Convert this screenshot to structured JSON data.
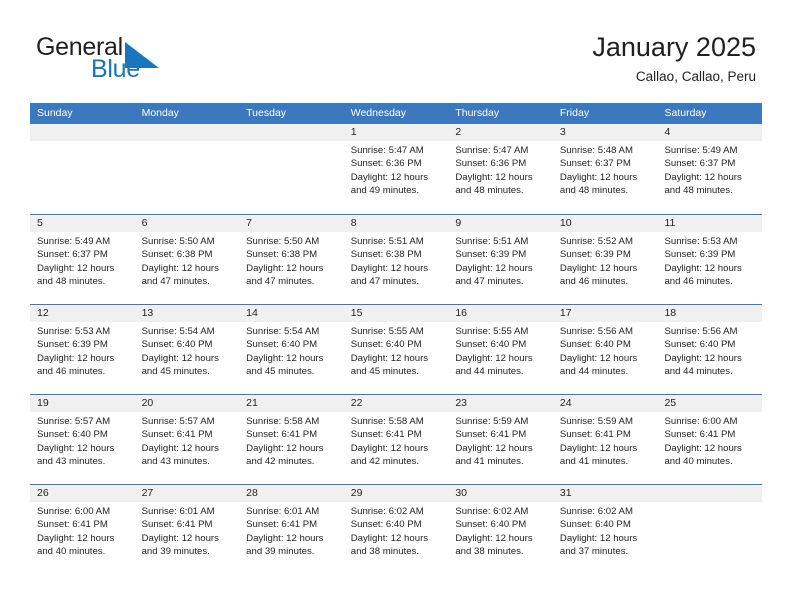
{
  "brand": {
    "name_part1": "General",
    "name_part2": "Blue",
    "flag_color": "#1b75bb",
    "text_color": "#231f20"
  },
  "header": {
    "title": "January 2025",
    "location": "Callao, Callao, Peru",
    "accent_color": "#3b78bd",
    "day_band_color": "#f0f0f0"
  },
  "weekdays": [
    "Sunday",
    "Monday",
    "Tuesday",
    "Wednesday",
    "Thursday",
    "Friday",
    "Saturday"
  ],
  "weeks": [
    [
      {
        "day": "",
        "lines": []
      },
      {
        "day": "",
        "lines": []
      },
      {
        "day": "",
        "lines": []
      },
      {
        "day": "1",
        "lines": [
          "Sunrise: 5:47 AM",
          "Sunset: 6:36 PM",
          "Daylight: 12 hours",
          "and 49 minutes."
        ]
      },
      {
        "day": "2",
        "lines": [
          "Sunrise: 5:47 AM",
          "Sunset: 6:36 PM",
          "Daylight: 12 hours",
          "and 48 minutes."
        ]
      },
      {
        "day": "3",
        "lines": [
          "Sunrise: 5:48 AM",
          "Sunset: 6:37 PM",
          "Daylight: 12 hours",
          "and 48 minutes."
        ]
      },
      {
        "day": "4",
        "lines": [
          "Sunrise: 5:49 AM",
          "Sunset: 6:37 PM",
          "Daylight: 12 hours",
          "and 48 minutes."
        ]
      }
    ],
    [
      {
        "day": "5",
        "lines": [
          "Sunrise: 5:49 AM",
          "Sunset: 6:37 PM",
          "Daylight: 12 hours",
          "and 48 minutes."
        ]
      },
      {
        "day": "6",
        "lines": [
          "Sunrise: 5:50 AM",
          "Sunset: 6:38 PM",
          "Daylight: 12 hours",
          "and 47 minutes."
        ]
      },
      {
        "day": "7",
        "lines": [
          "Sunrise: 5:50 AM",
          "Sunset: 6:38 PM",
          "Daylight: 12 hours",
          "and 47 minutes."
        ]
      },
      {
        "day": "8",
        "lines": [
          "Sunrise: 5:51 AM",
          "Sunset: 6:38 PM",
          "Daylight: 12 hours",
          "and 47 minutes."
        ]
      },
      {
        "day": "9",
        "lines": [
          "Sunrise: 5:51 AM",
          "Sunset: 6:39 PM",
          "Daylight: 12 hours",
          "and 47 minutes."
        ]
      },
      {
        "day": "10",
        "lines": [
          "Sunrise: 5:52 AM",
          "Sunset: 6:39 PM",
          "Daylight: 12 hours",
          "and 46 minutes."
        ]
      },
      {
        "day": "11",
        "lines": [
          "Sunrise: 5:53 AM",
          "Sunset: 6:39 PM",
          "Daylight: 12 hours",
          "and 46 minutes."
        ]
      }
    ],
    [
      {
        "day": "12",
        "lines": [
          "Sunrise: 5:53 AM",
          "Sunset: 6:39 PM",
          "Daylight: 12 hours",
          "and 46 minutes."
        ]
      },
      {
        "day": "13",
        "lines": [
          "Sunrise: 5:54 AM",
          "Sunset: 6:40 PM",
          "Daylight: 12 hours",
          "and 45 minutes."
        ]
      },
      {
        "day": "14",
        "lines": [
          "Sunrise: 5:54 AM",
          "Sunset: 6:40 PM",
          "Daylight: 12 hours",
          "and 45 minutes."
        ]
      },
      {
        "day": "15",
        "lines": [
          "Sunrise: 5:55 AM",
          "Sunset: 6:40 PM",
          "Daylight: 12 hours",
          "and 45 minutes."
        ]
      },
      {
        "day": "16",
        "lines": [
          "Sunrise: 5:55 AM",
          "Sunset: 6:40 PM",
          "Daylight: 12 hours",
          "and 44 minutes."
        ]
      },
      {
        "day": "17",
        "lines": [
          "Sunrise: 5:56 AM",
          "Sunset: 6:40 PM",
          "Daylight: 12 hours",
          "and 44 minutes."
        ]
      },
      {
        "day": "18",
        "lines": [
          "Sunrise: 5:56 AM",
          "Sunset: 6:40 PM",
          "Daylight: 12 hours",
          "and 44 minutes."
        ]
      }
    ],
    [
      {
        "day": "19",
        "lines": [
          "Sunrise: 5:57 AM",
          "Sunset: 6:40 PM",
          "Daylight: 12 hours",
          "and 43 minutes."
        ]
      },
      {
        "day": "20",
        "lines": [
          "Sunrise: 5:57 AM",
          "Sunset: 6:41 PM",
          "Daylight: 12 hours",
          "and 43 minutes."
        ]
      },
      {
        "day": "21",
        "lines": [
          "Sunrise: 5:58 AM",
          "Sunset: 6:41 PM",
          "Daylight: 12 hours",
          "and 42 minutes."
        ]
      },
      {
        "day": "22",
        "lines": [
          "Sunrise: 5:58 AM",
          "Sunset: 6:41 PM",
          "Daylight: 12 hours",
          "and 42 minutes."
        ]
      },
      {
        "day": "23",
        "lines": [
          "Sunrise: 5:59 AM",
          "Sunset: 6:41 PM",
          "Daylight: 12 hours",
          "and 41 minutes."
        ]
      },
      {
        "day": "24",
        "lines": [
          "Sunrise: 5:59 AM",
          "Sunset: 6:41 PM",
          "Daylight: 12 hours",
          "and 41 minutes."
        ]
      },
      {
        "day": "25",
        "lines": [
          "Sunrise: 6:00 AM",
          "Sunset: 6:41 PM",
          "Daylight: 12 hours",
          "and 40 minutes."
        ]
      }
    ],
    [
      {
        "day": "26",
        "lines": [
          "Sunrise: 6:00 AM",
          "Sunset: 6:41 PM",
          "Daylight: 12 hours",
          "and 40 minutes."
        ]
      },
      {
        "day": "27",
        "lines": [
          "Sunrise: 6:01 AM",
          "Sunset: 6:41 PM",
          "Daylight: 12 hours",
          "and 39 minutes."
        ]
      },
      {
        "day": "28",
        "lines": [
          "Sunrise: 6:01 AM",
          "Sunset: 6:41 PM",
          "Daylight: 12 hours",
          "and 39 minutes."
        ]
      },
      {
        "day": "29",
        "lines": [
          "Sunrise: 6:02 AM",
          "Sunset: 6:40 PM",
          "Daylight: 12 hours",
          "and 38 minutes."
        ]
      },
      {
        "day": "30",
        "lines": [
          "Sunrise: 6:02 AM",
          "Sunset: 6:40 PM",
          "Daylight: 12 hours",
          "and 38 minutes."
        ]
      },
      {
        "day": "31",
        "lines": [
          "Sunrise: 6:02 AM",
          "Sunset: 6:40 PM",
          "Daylight: 12 hours",
          "and 37 minutes."
        ]
      },
      {
        "day": "",
        "lines": []
      }
    ]
  ]
}
